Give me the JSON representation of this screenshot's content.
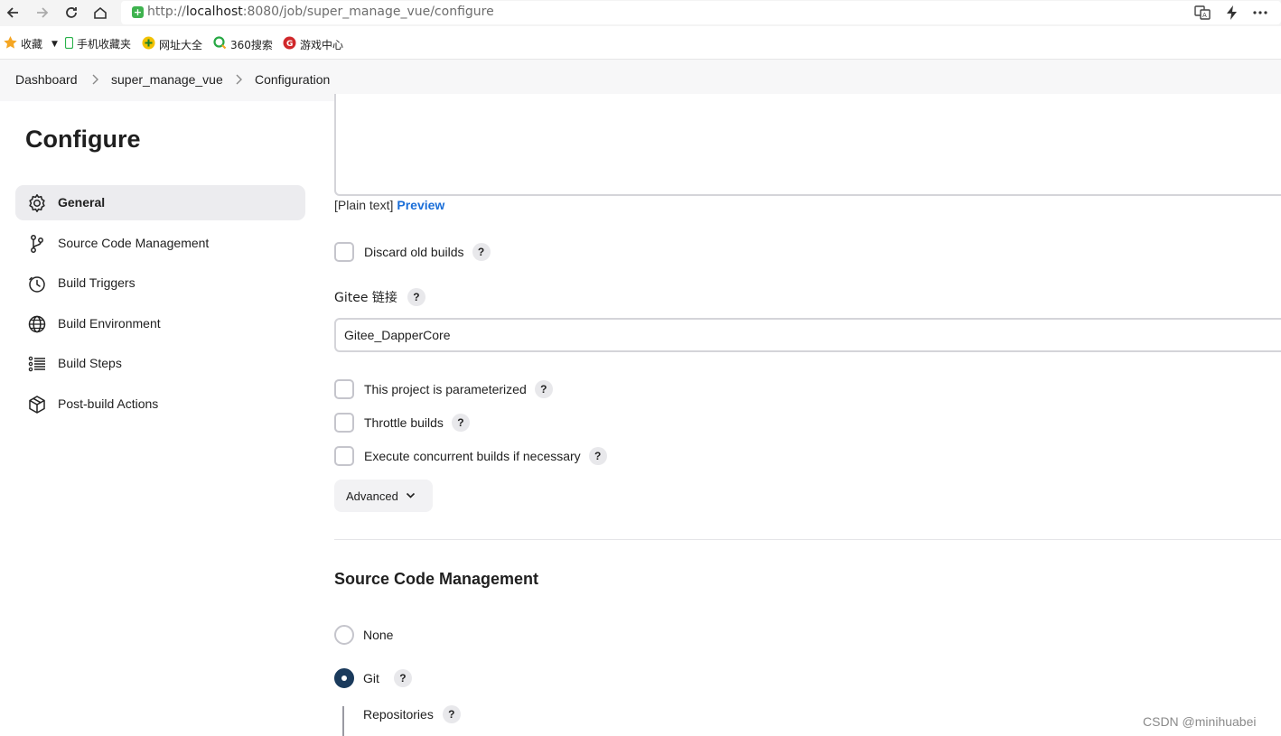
{
  "browser": {
    "url_scheme": "http://",
    "url_host": "localhost",
    "url_path": ":8080/job/super_manage_vue/configure",
    "bookmarks": [
      {
        "label": "收藏",
        "icon": "star-icon"
      },
      {
        "label": "手机收藏夹",
        "icon": "phone-icon"
      },
      {
        "label": "网址大全",
        "icon": "globe-add-icon"
      },
      {
        "label": "360搜索",
        "icon": "search-360-icon"
      },
      {
        "label": "游戏中心",
        "icon": "game-icon"
      }
    ]
  },
  "breadcrumb": [
    "Dashboard",
    "super_manage_vue",
    "Configuration"
  ],
  "sidebar": {
    "title": "Configure",
    "items": [
      {
        "label": "General",
        "icon": "gear-icon",
        "active": true
      },
      {
        "label": "Source Code Management",
        "icon": "git-branch-icon",
        "active": false
      },
      {
        "label": "Build Triggers",
        "icon": "timer-icon",
        "active": false
      },
      {
        "label": "Build Environment",
        "icon": "globe-icon",
        "active": false
      },
      {
        "label": "Build Steps",
        "icon": "list-icon",
        "active": false
      },
      {
        "label": "Post-build Actions",
        "icon": "package-icon",
        "active": false
      }
    ]
  },
  "general": {
    "description_format": "[Plain text]",
    "preview_link": "Preview",
    "discard_old_builds": "Discard old builds",
    "gitee_label": "Gitee 链接",
    "gitee_value": "Gitee_DapperCore",
    "parameterized": "This project is parameterized",
    "throttle": "Throttle builds",
    "concurrent": "Execute concurrent builds if necessary",
    "advanced": "Advanced",
    "help": "?"
  },
  "scm": {
    "title": "Source Code Management",
    "options": [
      {
        "label": "None",
        "selected": false
      },
      {
        "label": "Git",
        "selected": true
      }
    ],
    "repositories": "Repositories"
  },
  "watermark": "CSDN @minihuabei"
}
